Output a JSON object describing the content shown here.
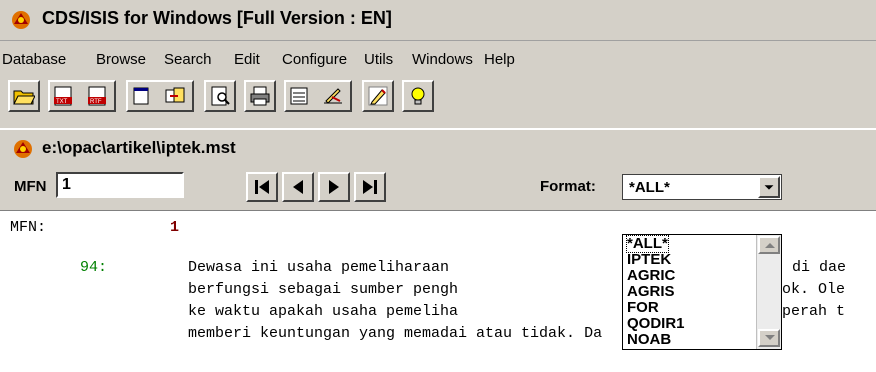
{
  "app": {
    "title": "CDS/ISIS for Windows [Full Version : EN]"
  },
  "menu": [
    "Database",
    "Browse",
    "Search",
    "Edit",
    "Configure",
    "Utils",
    "Windows",
    "Help"
  ],
  "toolbar": {
    "icons": [
      "open-folder-icon",
      "txt-icon",
      "rtf-icon",
      "browse-window-icon",
      "copy-records-icon",
      "print-preview-icon",
      "print-icon",
      "form-icon",
      "worksheet-edit-icon",
      "pencil-icon",
      "lightbulb-icon"
    ]
  },
  "document": {
    "title": "e:\\opac\\artikel\\iptek.mst"
  },
  "navigation": {
    "mfn_label": "MFN",
    "mfn_value": "1",
    "format_label": "Format:",
    "format_value": "*ALL*"
  },
  "format_options": [
    "*ALL*",
    "IPTEK",
    "AGRIC",
    "AGRIS",
    "FOR",
    "QODIR1",
    "NOAB"
  ],
  "record": {
    "mfn_label": "MFN:",
    "mfn_value": "1",
    "tag": "94:",
    "lines": [
      "Dewasa ini usaha pemeliharaan",
      "berfungsi sebagai sumber pengh",
      "ke waktu apakah usaha pemeliha",
      "memberi keuntungan yang memadai atau tidak. Da"
    ],
    "lines_right": [
      "di dae",
      "ok. Ole",
      "perah t"
    ]
  },
  "colors": {
    "face": "#d4d0c8",
    "mfn_number": "#800000",
    "tag": "#008000"
  }
}
